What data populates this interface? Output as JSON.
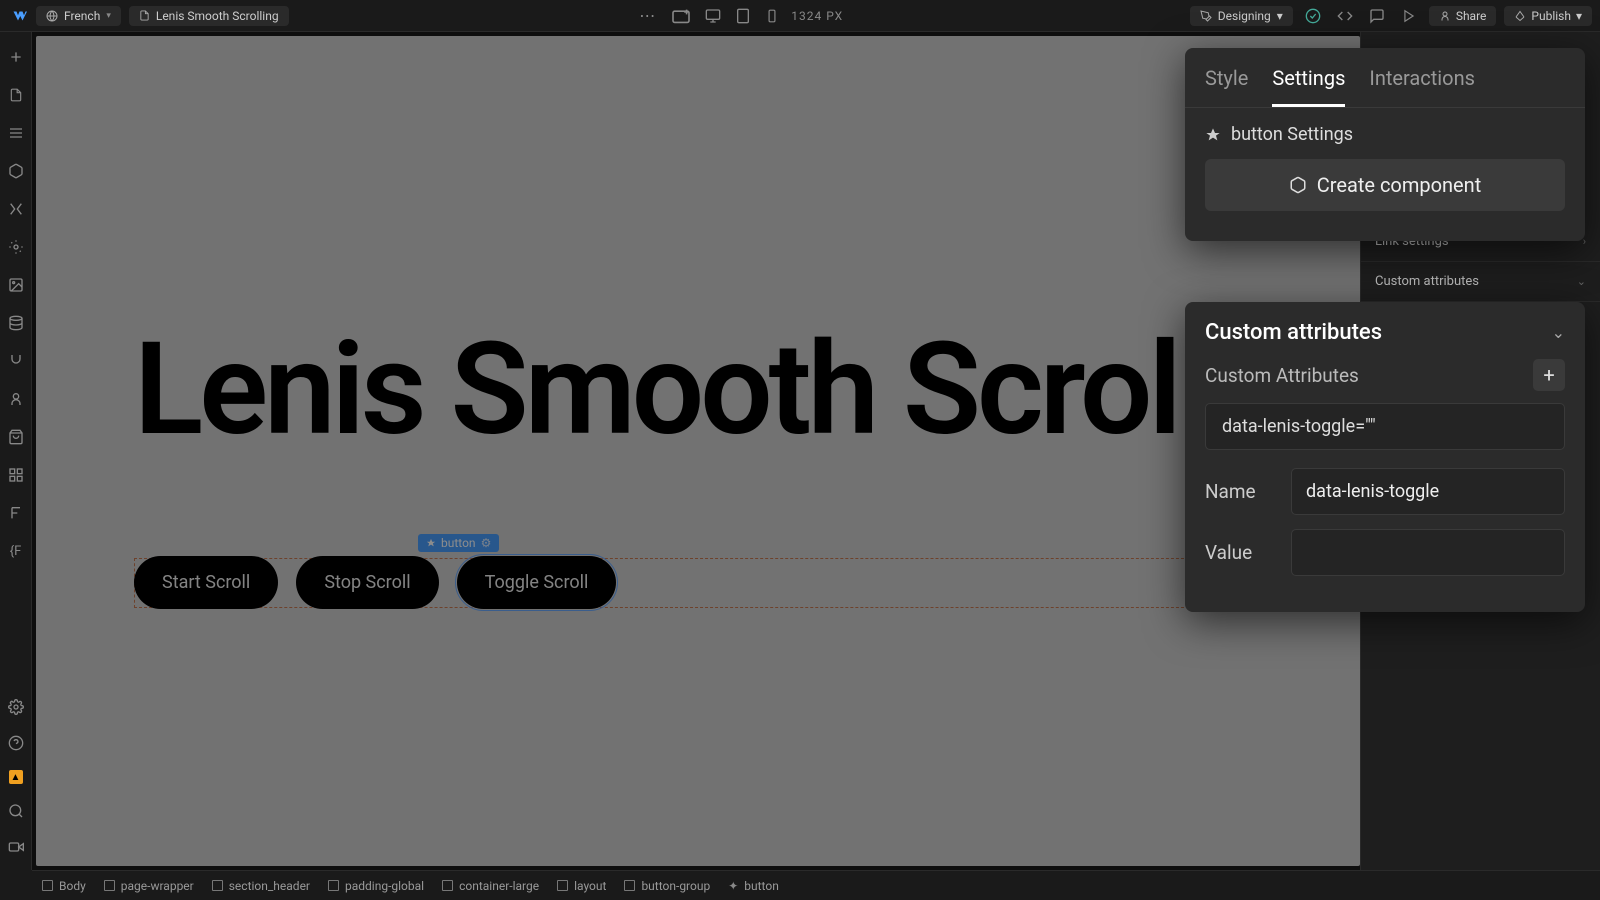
{
  "topbar": {
    "locale": "French",
    "page_name": "Lenis Smooth Scrolling",
    "breakpoint_size": "1324 PX",
    "mode": "Designing",
    "share": "Share",
    "publish": "Publish"
  },
  "canvas": {
    "hero_text": "Lenis Smooth Scroll",
    "buttons": [
      "Start Scroll",
      "Stop Scroll",
      "Toggle Scroll"
    ],
    "selected_tag": "button"
  },
  "right_sidebar": {
    "link_settings": "Link settings",
    "custom_attributes": "Custom attributes"
  },
  "panel_top": {
    "tabs": {
      "style": "Style",
      "settings": "Settings",
      "interactions": "Interactions"
    },
    "element_label": "button Settings",
    "create_component": "Create component"
  },
  "panel_attrs": {
    "title": "Custom attributes",
    "subtitle": "Custom Attributes",
    "chip": "data-lenis-toggle=\"\"",
    "name_label": "Name",
    "name_value": "data-lenis-toggle",
    "value_label": "Value",
    "value_value": ""
  },
  "breadcrumb": [
    "Body",
    "page-wrapper",
    "section_header",
    "padding-global",
    "container-large",
    "layout",
    "button-group",
    "button"
  ]
}
